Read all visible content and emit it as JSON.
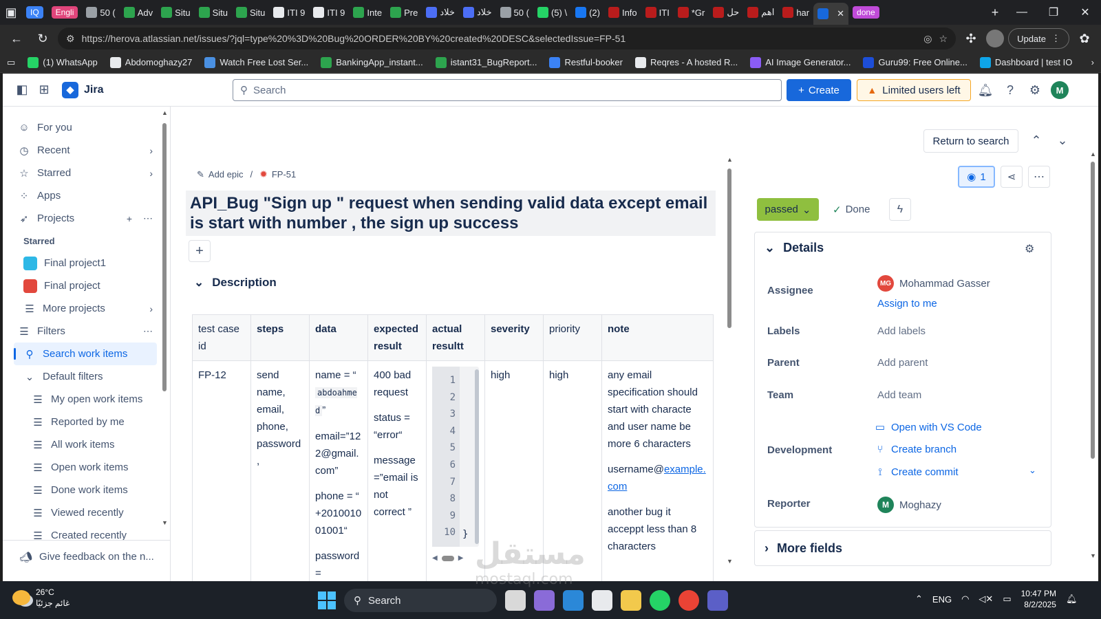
{
  "browser": {
    "tabs": [
      {
        "label": "",
        "pill": "IQ",
        "color": "#3b82f6"
      },
      {
        "label": "",
        "pill": "Engli",
        "color": "#e0457b"
      },
      {
        "label": "50 (",
        "color": "#9aa0a6"
      },
      {
        "label": "Adv",
        "color": "#2da44e"
      },
      {
        "label": "Situ",
        "color": "#2da44e"
      },
      {
        "label": "Situ",
        "color": "#2da44e"
      },
      {
        "label": "Situ",
        "color": "#2da44e"
      },
      {
        "label": "ITI 9",
        "color": "#e8eaed"
      },
      {
        "label": "ITI 9",
        "color": "#e8eaed"
      },
      {
        "label": "Inte",
        "color": "#2da44e"
      },
      {
        "label": "Pre",
        "color": "#2da44e"
      },
      {
        "label": "خلاد",
        "color": "#4c6ef5"
      },
      {
        "label": "خلاد",
        "color": "#4c6ef5"
      },
      {
        "label": "50 (",
        "color": "#9aa0a6"
      },
      {
        "label": "(5) \\",
        "color": "#25d366"
      },
      {
        "label": "(2)",
        "color": "#1877f2"
      },
      {
        "label": "Info",
        "color": "#b91c1c"
      },
      {
        "label": "ITI",
        "color": "#b91c1c"
      },
      {
        "label": "*Gr",
        "color": "#b91c1c"
      },
      {
        "label": "حل",
        "color": "#b91c1c"
      },
      {
        "label": "اهم",
        "color": "#b91c1c"
      },
      {
        "label": "har",
        "color": "#b91c1c"
      },
      {
        "label": "",
        "color": "#1868db"
      },
      {
        "label": "",
        "pill": "done",
        "color": "#c04bd8"
      }
    ],
    "url": "https://herova.atlassian.net/issues/?jql=type%20%3D%20Bug%20ORDER%20BY%20created%20DESC&selectedIssue=FP-51",
    "update_label": "Update",
    "bookmarks": [
      {
        "label": "(1) WhatsApp",
        "color": "#25d366"
      },
      {
        "label": "Abdomoghazy27",
        "color": "#e8eaed"
      },
      {
        "label": "Watch Free Lost Ser...",
        "color": "#4a90e2"
      },
      {
        "label": "BankingApp_instant...",
        "color": "#2da44e"
      },
      {
        "label": "istant31_BugReport...",
        "color": "#2da44e"
      },
      {
        "label": "Restful-booker",
        "color": "#3b82f6"
      },
      {
        "label": "Reqres - A hosted R...",
        "color": "#e8eaed"
      },
      {
        "label": "AI Image Generator...",
        "color": "#8b5cf6"
      },
      {
        "label": "Guru99: Free Online...",
        "color": "#1d4ed8"
      },
      {
        "label": "Dashboard | test IO",
        "color": "#0ea5e9"
      }
    ]
  },
  "app": {
    "name": "Jira",
    "search_placeholder": "Search",
    "create_label": "Create",
    "limited_label": "Limited users left",
    "user_initial": "M"
  },
  "sidebar": {
    "for_you": "For you",
    "recent": "Recent",
    "starred": "Starred",
    "apps": "Apps",
    "projects": "Projects",
    "starred_head": "Starred",
    "project1": "Final project1",
    "project2": "Final project",
    "more_projects": "More projects",
    "filters": "Filters",
    "search_work_items": "Search work items",
    "default_filters": "Default filters",
    "filter_items": [
      "My open work items",
      "Reported by me",
      "All work items",
      "Open work items",
      "Done work items",
      "Viewed recently",
      "Created recently"
    ],
    "feedback": "Give feedback on the n..."
  },
  "issue": {
    "add_epic": "Add epic",
    "key": "FP-51",
    "title": "API_Bug \"Sign up \" request when sending valid data except email is start with number , the sign up success",
    "description_label": "Description",
    "table": {
      "headers": [
        "test case id",
        "steps",
        "data",
        "expected result",
        "actual resultt",
        "severity",
        "priority",
        "note"
      ],
      "row": {
        "id": "FP-12",
        "steps": "send name, email, phone, password ,",
        "data_name_pre": "name = “",
        "data_name_code": "abdoahmed",
        "data_name_post": "”",
        "data_email": "email=”122@gmail.com”",
        "data_phone": "phone = “ +201001001001“",
        "data_password": "password =",
        "expected_1": "400 bad request",
        "expected_2": "status = “error“",
        "expected_3": "message =”email is not correct ”",
        "code_lines": [
          "1",
          "2",
          "3",
          "4",
          "5",
          "6",
          "7",
          "8",
          "9",
          "10"
        ],
        "code_brace": "}",
        "severity": "high",
        "priority": "high",
        "note_1": "any email specification should start with characte and user name be more 6 characters",
        "note_2_pre": "username@",
        "note_2_link": "example.com",
        "note_3": "another bug it acceppt less than 8 characters"
      }
    }
  },
  "right": {
    "return_label": "Return to search",
    "watch_count": "1",
    "status": "passed",
    "done_label": "Done",
    "details_label": "Details",
    "assignee_label": "Assignee",
    "assignee_initials": "MG",
    "assignee_name": "Mohammad Gasser",
    "assign_to_me": "Assign to me",
    "labels_label": "Labels",
    "labels_value": "Add labels",
    "parent_label": "Parent",
    "parent_value": "Add parent",
    "team_label": "Team",
    "team_value": "Add team",
    "development_label": "Development",
    "vs_code": "Open with VS Code",
    "create_branch": "Create branch",
    "create_commit": "Create commit",
    "reporter_label": "Reporter",
    "reporter_initial": "M",
    "reporter_name": "Moghazy",
    "more_fields": "More fields"
  },
  "taskbar": {
    "temp": "26°C",
    "weather": "غائم جزئيًا",
    "search": "Search",
    "lang": "ENG",
    "time": "10:47 PM",
    "date": "8/2/2025"
  },
  "watermark": {
    "arabic": "مستقل",
    "latin": "mostaql.com"
  }
}
